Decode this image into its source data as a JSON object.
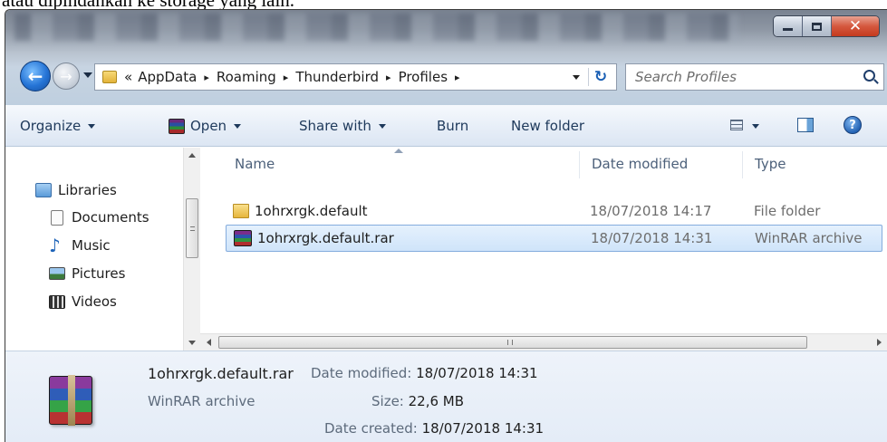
{
  "document_text": "atau dipindahkan ke storage yang lain.",
  "window": {
    "controls": {
      "minimize": "",
      "maximize": "",
      "close": "✕"
    }
  },
  "address_bar": {
    "overflow": "«",
    "crumbs": [
      "AppData",
      "Roaming",
      "Thunderbird",
      "Profiles"
    ],
    "separator": "▸"
  },
  "search": {
    "placeholder": "Search Profiles"
  },
  "command_bar": {
    "organize": "Organize",
    "open": "Open",
    "share_with": "Share with",
    "burn": "Burn",
    "new_folder": "New folder",
    "help": "?"
  },
  "nav_pane": {
    "items": [
      {
        "label": "Libraries",
        "icon": "libraries-icon"
      },
      {
        "label": "Documents",
        "icon": "documents-icon"
      },
      {
        "label": "Music",
        "icon": "music-icon"
      },
      {
        "label": "Pictures",
        "icon": "pictures-icon"
      },
      {
        "label": "Videos",
        "icon": "videos-icon"
      }
    ]
  },
  "file_list": {
    "columns": {
      "name": "Name",
      "date_modified": "Date modified",
      "type": "Type"
    },
    "rows": [
      {
        "name": "1ohrxrgk.default",
        "date": "18/07/2018 14:17",
        "type": "File folder",
        "icon": "folder-icon",
        "selected": false
      },
      {
        "name": "1ohrxrgk.default.rar",
        "date": "18/07/2018 14:31",
        "type": "WinRAR archive",
        "icon": "winrar-icon",
        "selected": true
      }
    ]
  },
  "details": {
    "filename": "1ohrxrgk.default.rar",
    "type": "WinRAR archive",
    "date_modified_label": "Date modified:",
    "date_modified": "18/07/2018 14:31",
    "size_label": "Size:",
    "size": "22,6 MB",
    "date_created_label": "Date created:",
    "date_created": "18/07/2018 14:31"
  }
}
